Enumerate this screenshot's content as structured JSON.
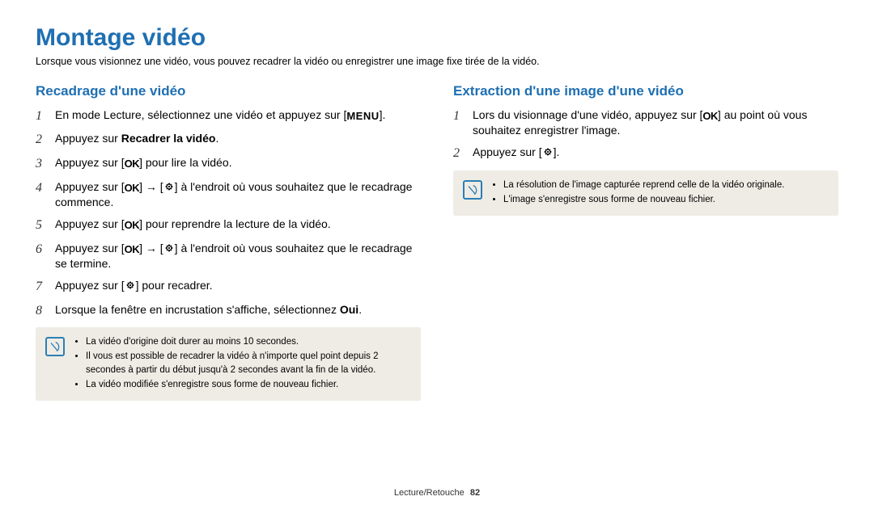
{
  "header": {
    "title": "Montage vidéo",
    "lead": "Lorsque vous visionnez une vidéo, vous pouvez recadrer la vidéo ou enregistrer une image fixe tirée de la vidéo."
  },
  "icons": {
    "menu": "MENU",
    "ok": "OK"
  },
  "left": {
    "subtitle": "Recadrage d'une vidéo",
    "steps": [
      {
        "n": "1",
        "before": "En mode Lecture, sélectionnez une vidéo et appuyez sur [",
        "icon": "menu",
        "after": "]."
      },
      {
        "n": "2",
        "before": "Appuyez sur ",
        "bold": "Recadrer la vidéo",
        "after2": "."
      },
      {
        "n": "3",
        "before": "Appuyez sur [",
        "icon": "ok",
        "after": "] pour lire la vidéo."
      },
      {
        "n": "4",
        "before": "Appuyez sur [",
        "icon": "ok",
        "mid": "] → [",
        "icon2": "flower",
        "after": "] à l'endroit où vous souhaitez que le recadrage commence."
      },
      {
        "n": "5",
        "before": "Appuyez sur [",
        "icon": "ok",
        "after": "] pour reprendre la lecture de la vidéo."
      },
      {
        "n": "6",
        "before": "Appuyez sur [",
        "icon": "ok",
        "mid": "] → [",
        "icon2": "flower",
        "after": "] à l'endroit où vous souhaitez que le recadrage se termine."
      },
      {
        "n": "7",
        "before": "Appuyez sur [",
        "icon": "flower",
        "after": "] pour recadrer."
      },
      {
        "n": "8",
        "before": "Lorsque la fenêtre en incrustation s'affiche, sélectionnez ",
        "bold": "Oui",
        "after2": "."
      }
    ],
    "note": [
      "La vidéo d'origine doit durer au moins 10 secondes.",
      "Il vous est possible de recadrer la vidéo à n'importe quel point depuis 2 secondes à partir du début jusqu'à 2 secondes avant la fin de la vidéo.",
      "La vidéo modifiée s'enregistre sous forme de nouveau fichier."
    ]
  },
  "right": {
    "subtitle": "Extraction d'une image d'une vidéo",
    "steps": [
      {
        "n": "1",
        "before": "Lors du visionnage d'une vidéo, appuyez sur [",
        "icon": "ok",
        "after": "] au point où vous souhaitez enregistrer l'image."
      },
      {
        "n": "2",
        "before": "Appuyez sur [",
        "icon": "flower",
        "after": "]."
      }
    ],
    "note": [
      "La résolution de l'image capturée reprend celle de la vidéo originale.",
      "L'image s'enregistre sous forme de nouveau fichier."
    ]
  },
  "footer": {
    "section": "Lecture/Retouche",
    "page": "82"
  }
}
